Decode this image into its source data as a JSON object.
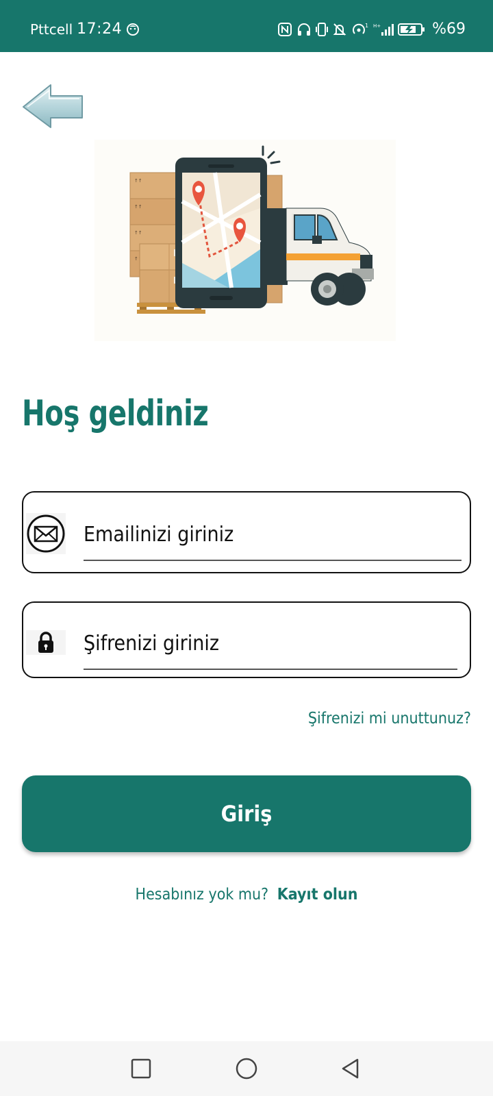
{
  "status_bar": {
    "carrier": "Pttcell",
    "time": "17:24",
    "battery": "%69",
    "icons": [
      "nfc-icon",
      "headphones-icon",
      "vibrate-icon",
      "mute-icon",
      "hotspot-icon",
      "signal-icon",
      "battery-icon"
    ]
  },
  "back": {
    "icon": "back-arrow-icon"
  },
  "hero": {
    "icon": "delivery-truck-map-illustration"
  },
  "welcome": {
    "title": "Hoş geldiniz"
  },
  "email": {
    "icon": "mail-icon",
    "placeholder": "Emailinizi giriniz"
  },
  "password": {
    "icon": "lock-icon",
    "placeholder": "Şifrenizi giriniz"
  },
  "forgot_password": "Şifrenizi mi unuttunuz?",
  "login_button": "Giriş",
  "signup": {
    "question": "Hesabınız yok mu?",
    "link": "Kayıt olun"
  },
  "nav": {
    "icons": [
      "recents-square-icon",
      "home-circle-icon",
      "back-triangle-icon"
    ]
  },
  "colors": {
    "primary": "#17766b",
    "background": "#ffffff"
  }
}
